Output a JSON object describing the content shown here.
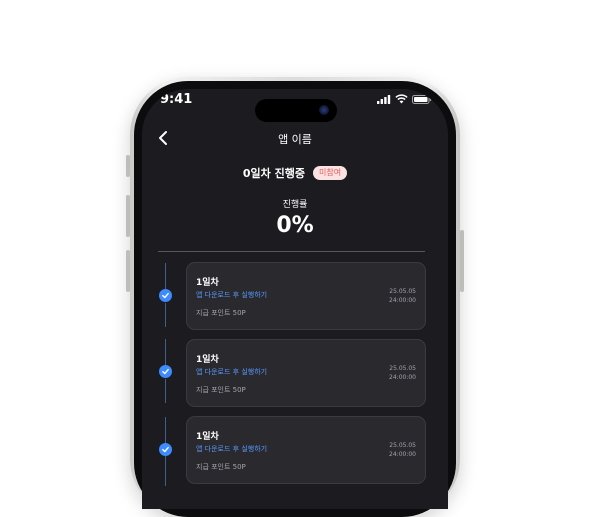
{
  "status_bar": {
    "time": "9:41"
  },
  "nav": {
    "title": "앱 이름"
  },
  "progress": {
    "day_status": "0일차 진행중",
    "badge": "미참여",
    "rate_label": "진행률",
    "rate_value": "0%"
  },
  "colors": {
    "screen_bg": "#1c1c20",
    "card_bg": "#29292e",
    "accent_blue": "#3d8bff",
    "badge_red": "#ea5a5a"
  },
  "days": [
    {
      "title": "1일차",
      "mission": "앱 다운로드 후 실행하기",
      "reward": "지급 포인트 50P",
      "date": "25.05.05",
      "time": "24:00:00",
      "completed": true
    },
    {
      "title": "1일차",
      "mission": "앱 다운로드 후 실행하기",
      "reward": "지급 포인트 50P",
      "date": "25.05.05",
      "time": "24:00:00",
      "completed": true
    },
    {
      "title": "1일차",
      "mission": "앱 다운로드 후 실행하기",
      "reward": "지급 포인트 50P",
      "date": "25.05.05",
      "time": "24:00:00",
      "completed": true
    }
  ]
}
